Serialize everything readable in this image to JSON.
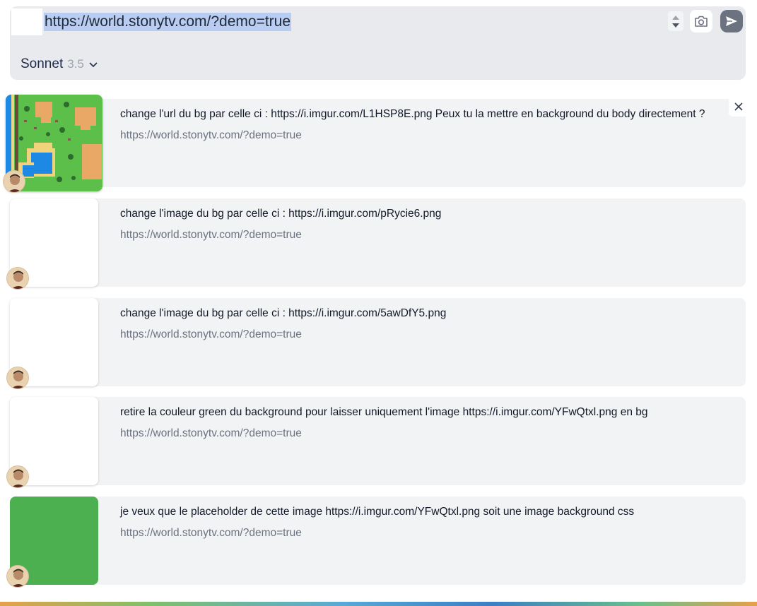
{
  "composer": {
    "prompt_value": "https://world.stonytv.com/?demo=true",
    "model_name": "Sonnet",
    "model_version": "3.5"
  },
  "icons": {
    "camera": "camera-icon",
    "send": "send-icon",
    "close": "close-icon",
    "chevron": "chevron-down-icon",
    "spinner": "number-spinner-icon"
  },
  "colors": {
    "selection_highlight": "#b9cdf2",
    "send_button": "#6b7280",
    "card_background": "#f2f3f5",
    "green_placeholder": "#4caf50"
  },
  "history": [
    {
      "text": "change l'url du bg par celle ci : https://i.imgur.com/L1HSP8E.png Peux tu la mettre en background du body directement ?",
      "url": "https://world.stonytv.com/?demo=true",
      "thumbnail": "pixel-map"
    },
    {
      "text": "change l'image du bg par celle ci : https://i.imgur.com/pRycie6.png",
      "url": "https://world.stonytv.com/?demo=true",
      "thumbnail": "blank"
    },
    {
      "text": "change l'image du bg par celle ci : https://i.imgur.com/5awDfY5.png",
      "url": "https://world.stonytv.com/?demo=true",
      "thumbnail": "blank"
    },
    {
      "text": "retire la couleur green du background pour laisser uniquement l'image https://i.imgur.com/YFwQtxl.png en bg",
      "url": "https://world.stonytv.com/?demo=true",
      "thumbnail": "blank"
    },
    {
      "text": "je veux que le placeholder de cette image https://i.imgur.com/YFwQtxl.png soit une image background css",
      "url": "https://world.stonytv.com/?demo=true",
      "thumbnail": "green"
    }
  ]
}
